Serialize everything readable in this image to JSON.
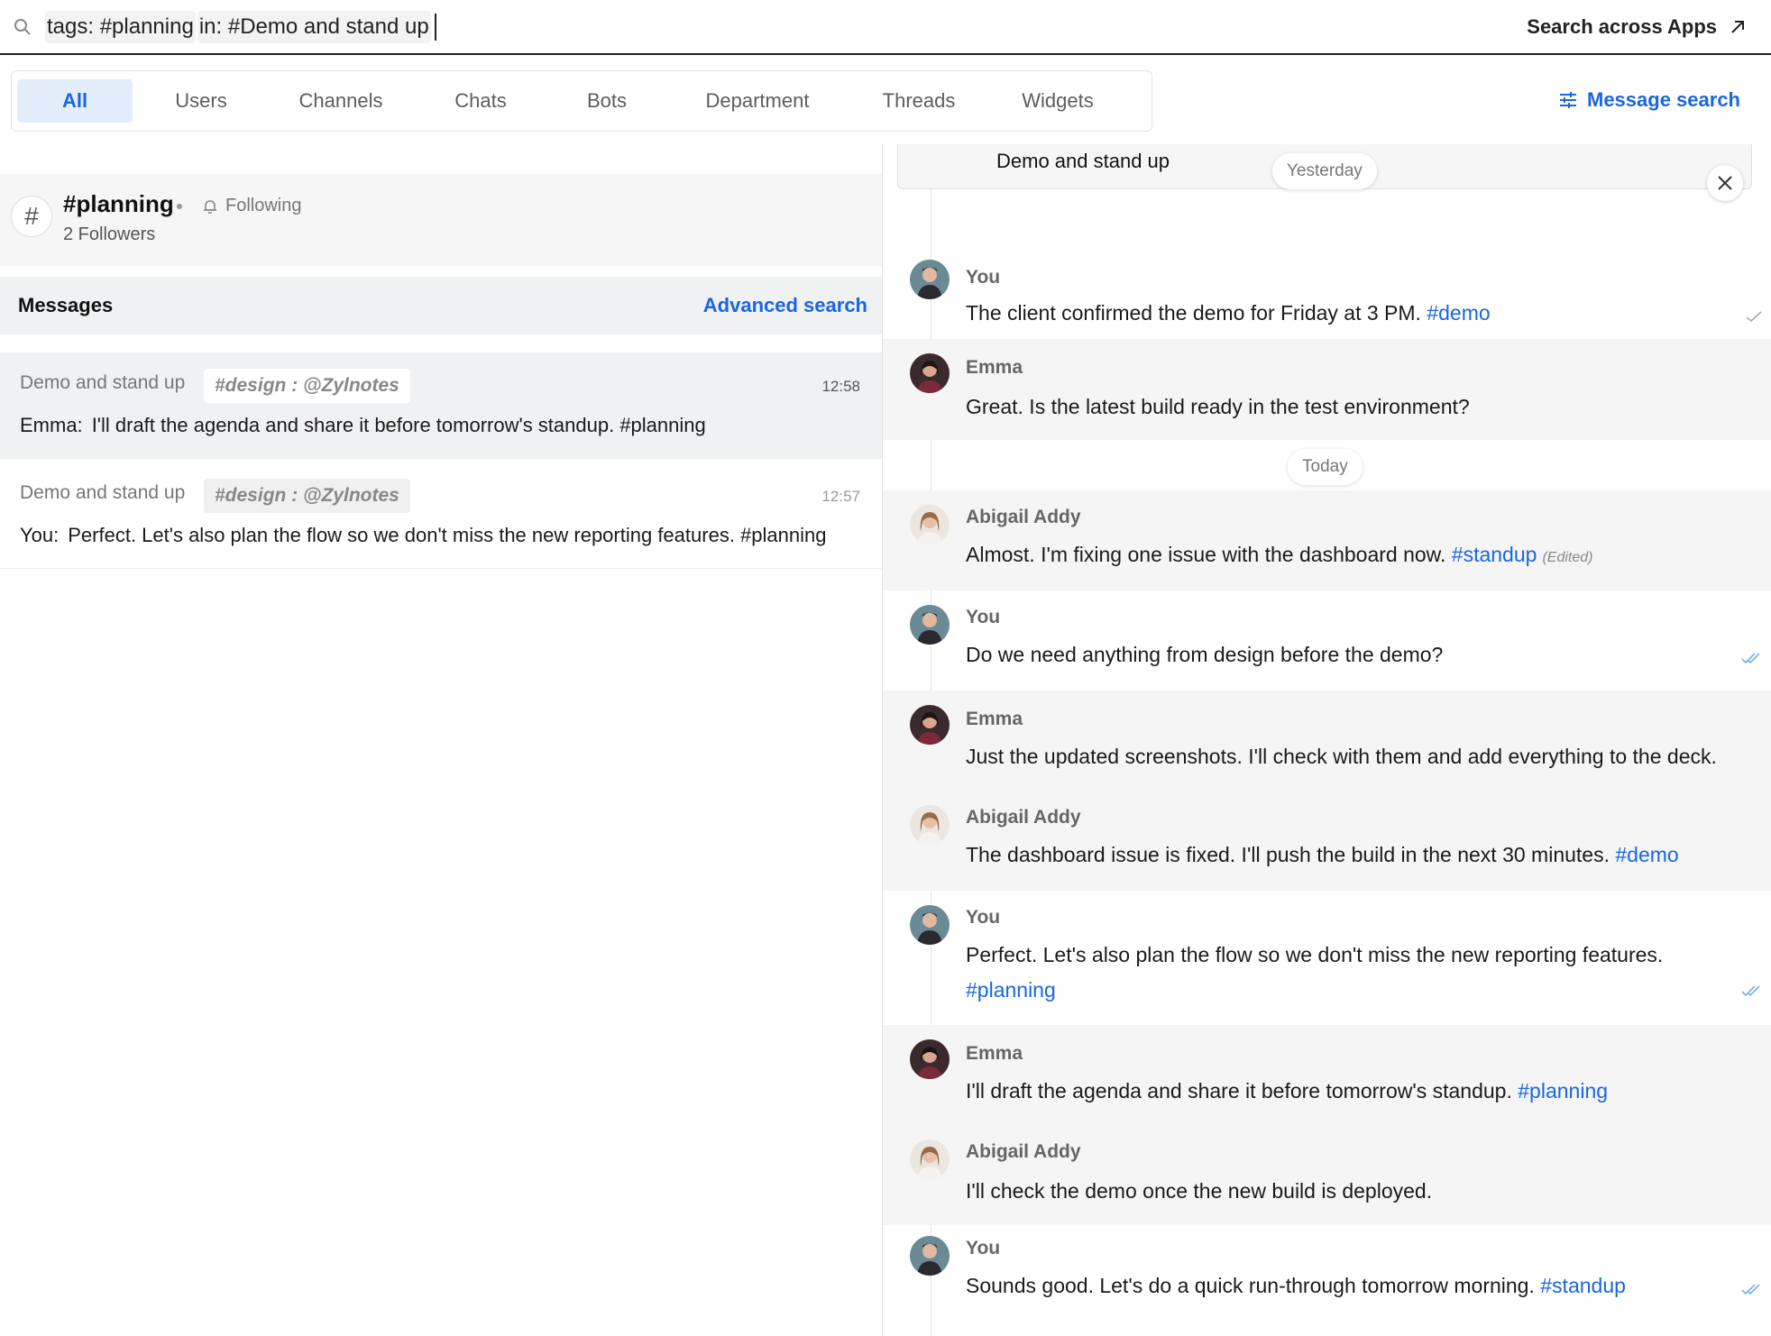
{
  "search": {
    "chip_tags": "tags:",
    "tags_value": "#planning",
    "chip_in": "in:",
    "in_value": "#Demo and stand up",
    "across_label": "Search across Apps"
  },
  "tabs": [
    {
      "label": "All",
      "active": true
    },
    {
      "label": "Users"
    },
    {
      "label": "Channels"
    },
    {
      "label": "Chats"
    },
    {
      "label": "Bots"
    },
    {
      "label": "Department"
    },
    {
      "label": "Threads"
    },
    {
      "label": "Widgets"
    }
  ],
  "message_search_label": "Message search",
  "channel": {
    "name": "#planning",
    "following_label": "Following",
    "followers": "2 Followers",
    "icon": "hash-icon"
  },
  "messages_header": {
    "title": "Messages",
    "advanced": "Advanced search"
  },
  "results": [
    {
      "title": "Demo and stand up",
      "tag": "#design : @Zylnotes",
      "time": "12:58",
      "who": "Emma:",
      "text": "I'll draft the agenda and share it before tomorrow's standup. #planning"
    },
    {
      "title": "Demo and stand up",
      "tag": "#design : @Zylnotes",
      "time": "12:57",
      "who": "You:",
      "text": "Perfect. Let's also plan the flow so we don't miss the new reporting features. #planning"
    }
  ],
  "thread": {
    "quote_title": "Demo and stand up",
    "date_yesterday": "Yesterday",
    "date_today": "Today",
    "messages": [
      {
        "sender": "You",
        "text": "The client confirmed the demo for Friday at 3 PM.",
        "hashtag": "#demo",
        "tick": "single"
      },
      {
        "sender": "Emma",
        "text": "Great. Is the latest build ready in the test environment?",
        "hashtag": ""
      },
      {
        "sender": "Abigail Addy",
        "text": "Almost. I'm fixing one issue with the dashboard now.",
        "hashtag": "#standup",
        "edited": "(Edited)"
      },
      {
        "sender": "You",
        "text": "Do we need anything from design before the demo?",
        "hashtag": "",
        "tick": "double"
      },
      {
        "sender": "Emma",
        "text": "Just the updated screenshots. I'll check with them and add everything to the deck.",
        "hashtag": ""
      },
      {
        "sender": "Abigail Addy",
        "text": "The dashboard issue is fixed. I'll push the build in the next 30 minutes.",
        "hashtag": "#demo"
      },
      {
        "sender": "You",
        "text": "Perfect. Let's also plan the flow so we don't miss the new reporting features.",
        "hashtag": "#planning",
        "tick": "double"
      },
      {
        "sender": "Emma",
        "text": "I'll draft the agenda and share it before tomorrow's standup.",
        "hashtag": "#planning"
      },
      {
        "sender": "Abigail Addy",
        "text": "I'll check the demo once the new build is deployed.",
        "hashtag": ""
      },
      {
        "sender": "You",
        "text": "Sounds good. Let's do a quick run-through tomorrow morning.",
        "hashtag": "#standup",
        "tick": "double"
      }
    ]
  },
  "colors": {
    "accent": "#1a66e0",
    "active_tab_bg": "#e3edfc",
    "row_grey": "#f5f5f6"
  }
}
